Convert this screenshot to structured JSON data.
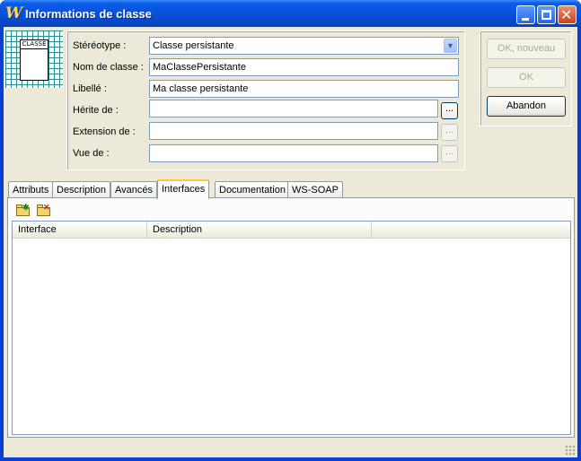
{
  "window": {
    "title": "Informations de classe",
    "app_icon_glyph": "W"
  },
  "class_icon": {
    "label": "CLASSE"
  },
  "form": {
    "stereotype": {
      "label": "Stéréotype :",
      "value": "Classe persistante"
    },
    "class_name": {
      "label": "Nom de classe :",
      "value": "MaClassePersistante"
    },
    "caption": {
      "label": "Libellé :",
      "value": "Ma classe persistante"
    },
    "inherits": {
      "label": "Hérite de :",
      "value": "",
      "browse": "..."
    },
    "extension": {
      "label": "Extension de :",
      "value": "",
      "browse": "..."
    },
    "view_of": {
      "label": "Vue de :",
      "value": "",
      "browse": "..."
    }
  },
  "buttons": {
    "ok_new": "OK, nouveau",
    "ok": "OK",
    "cancel": "Abandon"
  },
  "tabs": [
    "Attributs",
    "Description",
    "Avancés",
    "Interfaces",
    "Documentation",
    "WS-SOAP"
  ],
  "active_tab": "Interfaces",
  "toolbar": {
    "new_icon": "new-folder-icon",
    "delete_icon": "delete-folder-icon",
    "new_badge": "✱",
    "delete_badge": "✕"
  },
  "grid": {
    "columns": [
      "Interface",
      "Description"
    ],
    "rows": []
  },
  "colors": {
    "title_bar": "#0a52d8",
    "window_bg": "#ece9d8",
    "active_tab_accent": "#ffc83c"
  }
}
